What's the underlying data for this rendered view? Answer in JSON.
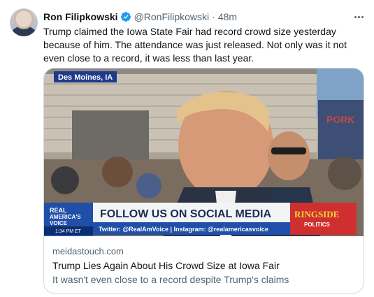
{
  "author": {
    "name": "Ron Filipkowski",
    "handle": "@RonFilipkowski",
    "separator": "·",
    "time": "48m"
  },
  "tweet": {
    "text": "Trump claimed the Iowa State Fair had record crowd size yesterday because of him. The attendance was just released. Not only was it not even close to a record, it was less than last year."
  },
  "card": {
    "domain": "meidastouch.com",
    "title": "Trump Lies Again About His Crowd Size at Iowa Fair",
    "description": "It wasn't even close to a record despite Trump's claims",
    "image_text": {
      "location": "Des Moines, IA",
      "network_line1": "REAL",
      "network_line2": "AMERICA'S",
      "network_line3": "VOICE",
      "time": "1:34 PM ET",
      "headline": "FOLLOW US ON SOCIAL MEDIA",
      "socials": "Twitter: @RealAmVoice | Instagram: @realamericasvoice",
      "show_logo_1": "RINGSIDE",
      "show_logo_2": "POLITICS"
    }
  },
  "colors": {
    "verified": "#1d9bf0",
    "text_secondary": "#536471",
    "border": "#cfd9de"
  }
}
